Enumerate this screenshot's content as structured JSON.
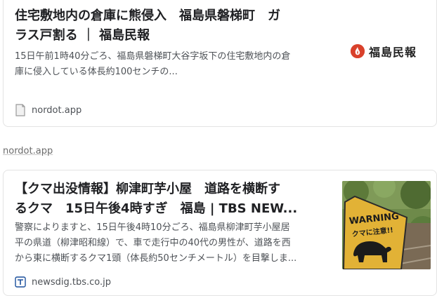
{
  "results": [
    {
      "title_line1": "住宅敷地内の倉庫に熊侵入　福島県磐梯町　ガ",
      "title_line2": "ラス戸割る ｜ 福島民報",
      "snippet_line1": "15日午前1時40分ごろ、福島県磐梯町大谷字坂下の住宅敷地内の倉",
      "snippet_line2": "庫に侵入している体長約100センチの...",
      "source": "nordot.app",
      "logo_text": "福島民報",
      "favicon": "document-icon",
      "accent_color": "#d9412b"
    },
    {
      "title_line1": "【クマ出没情報】柳津町芋小屋　道路を横断す",
      "title_line2": "るクマ　15日午後4時すぎ　福島 | TBS NEW...",
      "snippet_line1": "警察によりますと、15日午後4時10分ごろ、福島県柳津町芋小屋居",
      "snippet_line2": "平の県道（柳津昭和線）で、車で走行中の40代の男性が、道路を西",
      "snippet_line3": "から東に横断するクマ1頭（体長約50センチメートル）を目撃しま...",
      "source": "newsdig.tbs.co.jp",
      "thumbnail_sign_line1": "WARNING",
      "thumbnail_sign_line2": "クマに注意!!",
      "favicon": "tbs-icon"
    }
  ],
  "between_link": "nordot.app"
}
